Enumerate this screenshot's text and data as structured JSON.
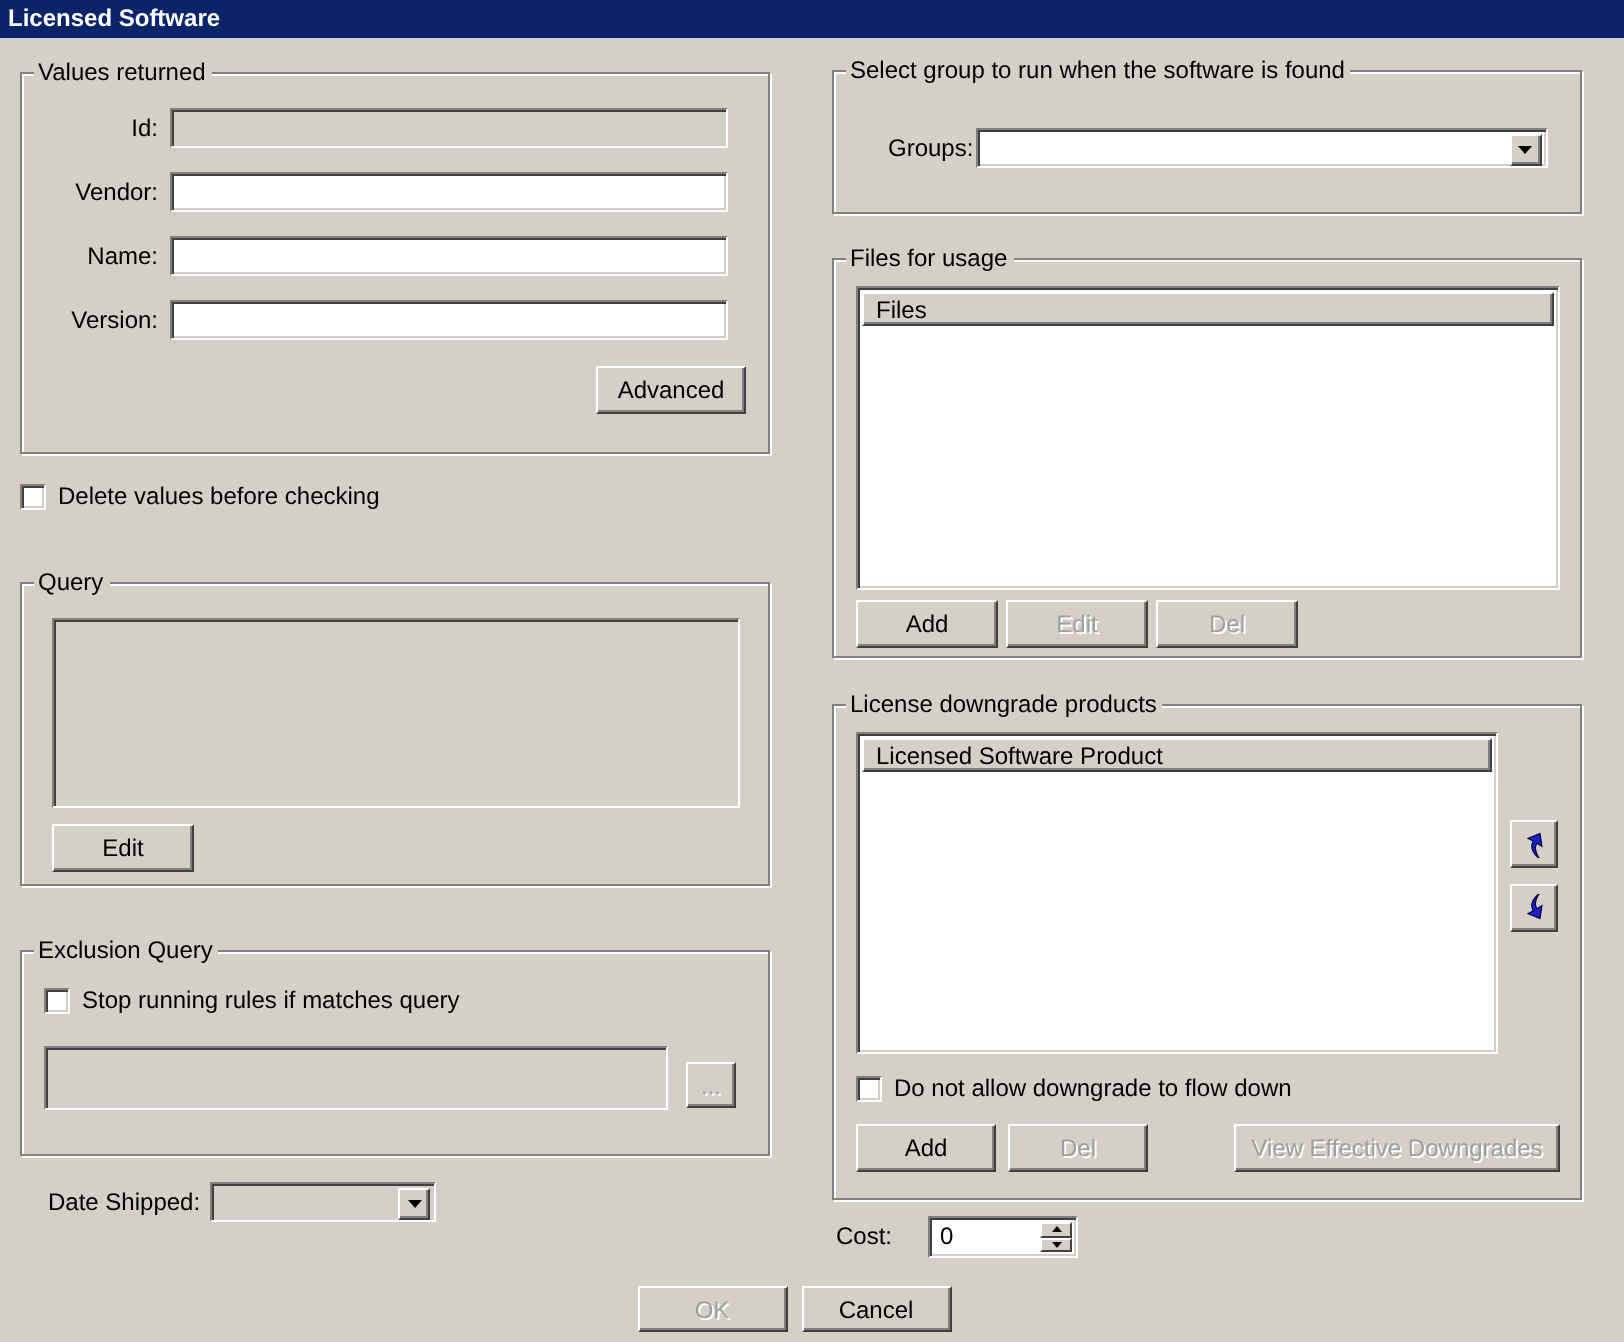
{
  "window": {
    "title": "Licensed Software"
  },
  "values_returned": {
    "title": "Values returned",
    "fields": [
      {
        "label": "Id:",
        "disabled": true
      },
      {
        "label": "Vendor:",
        "disabled": false
      },
      {
        "label": "Name:",
        "disabled": false
      },
      {
        "label": "Version:",
        "disabled": false
      }
    ],
    "button": {
      "label": "Advanced",
      "disabled": false
    }
  },
  "delete_values": {
    "label": "Delete values before checking",
    "checked": false
  },
  "query": {
    "title": "Query",
    "disabled": true,
    "button": {
      "label": "Edit",
      "disabled": false
    }
  },
  "exclusion_query": {
    "title": "Exclusion Query",
    "checkbox": {
      "label": "Stop running rules if matches query",
      "checked": false
    },
    "field_disabled": true,
    "browse_button": {
      "label": "...",
      "disabled": true
    }
  },
  "date_shipped": {
    "label": "Date Shipped:",
    "disabled": true
  },
  "group_select": {
    "title": "Select group to run when the software is found",
    "label": "Groups:"
  },
  "files": {
    "title": "Files for usage",
    "columns": [
      "Files"
    ],
    "buttons": [
      {
        "label": "Add",
        "disabled": false
      },
      {
        "label": "Edit",
        "disabled": true
      },
      {
        "label": "Del",
        "disabled": true
      }
    ]
  },
  "downgrades": {
    "title": "License downgrade products",
    "columns": [
      "Licensed Software Product"
    ],
    "checkbox": {
      "label": "Do not allow downgrade to flow down",
      "checked": false
    },
    "buttons": [
      {
        "label": "Add",
        "disabled": false
      },
      {
        "label": "Del",
        "disabled": true
      },
      {
        "label": "View Effective Downgrades",
        "disabled": true
      }
    ]
  },
  "cost": {
    "label": "Cost:",
    "value": "0"
  },
  "dialog_buttons": [
    {
      "label": "OK",
      "disabled": true
    },
    {
      "label": "Cancel",
      "disabled": false
    }
  ]
}
